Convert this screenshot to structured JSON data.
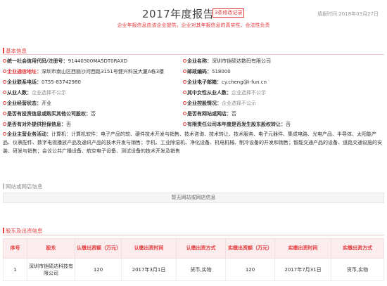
{
  "header": {
    "title": "2017年度报告",
    "modify_link": "3条修改记录",
    "fill_date": "填报时间:2018年03月27日",
    "subtitle": "企业年报信息由该企业提供，企业对其年报信息的真实性、合法性负责"
  },
  "basic_info": {
    "section_title": "基本信息",
    "credit_code": {
      "label": "统一社会信用代码/注册号：",
      "value": "91440300MA5DT0RAXD"
    },
    "company_name": {
      "label": "企业名称：",
      "value": "深圳市铠硕达数码有限公司"
    },
    "address": {
      "label": "企业通信地址：",
      "value": "深圳市南山区西丽沙河西路3151号健兴科技大厦A栋3楼"
    },
    "postcode": {
      "label": "邮政编码：",
      "value": "518000"
    },
    "phone": {
      "label": "企业联系电话：",
      "value": "0755-83742980"
    },
    "email": {
      "label": "企业电子邮箱：",
      "value": "cy.cheng@i-fun.cn"
    },
    "employees": {
      "label": "从业人数：",
      "value": "企业选择不公示"
    },
    "female_employees": {
      "label": "其中女性从业人数：",
      "value": "企业选择不公示"
    },
    "status": {
      "label": "企业经营状态：",
      "value": "开业"
    },
    "holding": {
      "label": "企业控股情况：",
      "value": "企业选择不公示"
    },
    "invest": {
      "label": "是否有投资信息或购买其他公司股权：",
      "value": "否"
    },
    "website": {
      "label": "是否有网站或网店：",
      "value": "否"
    },
    "guarantee": {
      "label": "是否有对外提供担保信息：",
      "value": "否"
    },
    "transfer": {
      "label": "有限责任公司本年度是否发生股东股权转让：",
      "value": "否"
    },
    "scope": {
      "label": "企业主营业务活动：",
      "value": "计算机：计算机软件：电子产品的软、硬件技术开发与销售、技术咨询、技术转让、技术服务、电子元器件、集成电路、光电产品、半导体、太阳能产品、仪表配件、数字电视播放产品及通讯产品的技术开发与销售；手机、工业除湿机、净化设备、机电机械、制冷设备的开发和销售；智能交通产品的设备、道路交通设施的安装、研发与销售；会议公共广播设备、航空电子设备、测试设备的技术开发及销售"
    }
  },
  "website_info": {
    "section_title": "网站或网店信息",
    "empty_text": "暂无网站或网店信息"
  },
  "shareholders": {
    "section_title": "股东及出资信息",
    "columns": [
      "序号",
      "股东",
      "认缴出资额（万元）",
      "认缴出资时间",
      "认缴出资方式",
      "实缴出资额（万元）",
      "实缴出资时间",
      "实缴出资方式"
    ],
    "rows": [
      [
        "1",
        "深圳市铠硕达科技有限公司",
        "120",
        "2017年3月1日",
        "货币,实物",
        "120",
        "2017年7月31日",
        "货币,实物"
      ]
    ]
  }
}
